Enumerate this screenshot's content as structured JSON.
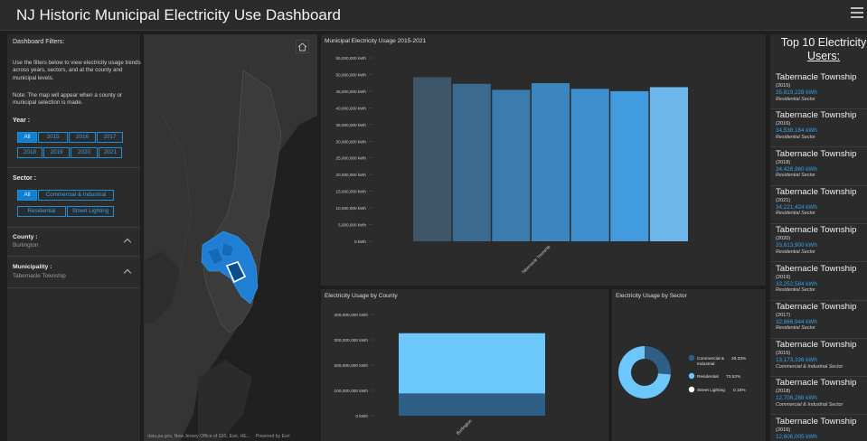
{
  "header": {
    "title": "NJ Historic Municipal Electricity Use Dashboard"
  },
  "filters": {
    "heading": "Dashboard Filters:",
    "intro": "Use the filters below to view electricity usage trends across years, sectors, and at the county and municipal levels.",
    "note": "Note: The map will appear when a county or municipal selection is made.",
    "year_label": "Year :",
    "years": [
      "All",
      "2015",
      "2016",
      "2017",
      "2018",
      "2019",
      "2020",
      "2021"
    ],
    "year_selected": "All",
    "sector_label": "Sector :",
    "sectors": [
      "All",
      "Commercial & Industrial",
      "Residential",
      "Street Lighting"
    ],
    "sector_selected": "All",
    "county_label": "County :",
    "county_value": "Burlington",
    "municipality_label": "Municipality :",
    "municipality_value": "Tabernacle Township"
  },
  "map": {
    "attribution": "data.pa.gov, New Jersey Office of GIS, Esri, HE...",
    "powered_by": "Powered by Esri",
    "home_icon": "home-icon"
  },
  "usage_chart": {
    "title": "Municipal Electricity Usage 2015-2021"
  },
  "county_chart": {
    "title": "Electricity Usage by County"
  },
  "sector_chart": {
    "title": "Electricity Usage by Sector"
  },
  "chart_data": [
    {
      "type": "bar",
      "title": "Municipal Electricity Usage 2015-2021",
      "categories": [
        "Tabernacle Township"
      ],
      "series": [
        {
          "values": [
            49200000
          ],
          "color": "#3f5568"
        },
        {
          "values": [
            47200000
          ],
          "color": "#3b6a90"
        },
        {
          "values": [
            45400000
          ],
          "color": "#3b7bae"
        },
        {
          "values": [
            47400000
          ],
          "color": "#3c86c0"
        },
        {
          "values": [
            45700000
          ],
          "color": "#3f8fcf"
        },
        {
          "values": [
            45000000
          ],
          "color": "#439bdf"
        },
        {
          "values": [
            46200000
          ],
          "color": "#6db6ea"
        }
      ],
      "y_ticks": [
        "0 kWh",
        "5,000,000 kWh",
        "10,000,000 kWh",
        "15,000,000 kWh",
        "20,000,000 kWh",
        "25,000,000 kWh",
        "30,000,000 kWh",
        "35,000,000 kWh",
        "40,000,000 kWh",
        "45,000,000 kWh",
        "50,000,000 kWh",
        "55,000,000 kWh"
      ],
      "ylim": [
        0,
        55000000
      ],
      "grid": false
    },
    {
      "type": "bar",
      "title": "Electricity Usage by County",
      "categories": [
        "Burlington"
      ],
      "stacked": true,
      "series": [
        {
          "values": [
            88000000
          ],
          "color": "#2e5f86"
        },
        {
          "values": [
            238000000
          ],
          "color": "#6cc8fb"
        }
      ],
      "y_ticks": [
        "0 kWh",
        "100,000,000 kWh",
        "200,000,000 kWh",
        "300,000,000 kWh",
        "400,000,000 kWh"
      ],
      "ylim": [
        0,
        400000000
      ],
      "grid": false
    },
    {
      "type": "pie",
      "title": "Electricity Usage by Sector",
      "donut": true,
      "slices": [
        {
          "name": "Commercial & Industrial",
          "value": 26.33,
          "label": "26.33%",
          "color": "#2e5f86"
        },
        {
          "name": "Residential",
          "value": 73.52,
          "label": "73.52%",
          "color": "#6cc8fb"
        },
        {
          "name": "Street Lighting",
          "value": 0.15,
          "label": "0.15%",
          "color": "#ffffff"
        }
      ],
      "legend": "right"
    }
  ],
  "top10": {
    "title_line1": "Top 10 Electricity",
    "title_line2": "Users:",
    "entries": [
      {
        "name": "Tabernacle Township",
        "year": "(2015)",
        "value": "35,819,228 kWh",
        "sector": "Residential Sector"
      },
      {
        "name": "Tabernacle Township",
        "year": "(2016)",
        "value": "34,538,184 kWh",
        "sector": "Residential Sector"
      },
      {
        "name": "Tabernacle Township",
        "year": "(2018)",
        "value": "34,428,960 kWh",
        "sector": "Residential Sector"
      },
      {
        "name": "Tabernacle Township",
        "year": "(2021)",
        "value": "34,221,424 kWh",
        "sector": "Residential Sector"
      },
      {
        "name": "Tabernacle Township",
        "year": "(2020)",
        "value": "33,613,900 kWh",
        "sector": "Residential Sector"
      },
      {
        "name": "Tabernacle Township",
        "year": "(2019)",
        "value": "33,252,584 kWh",
        "sector": "Residential Sector"
      },
      {
        "name": "Tabernacle Township",
        "year": "(2017)",
        "value": "32,866,944 kWh",
        "sector": "Residential Sector"
      },
      {
        "name": "Tabernacle Township",
        "year": "(2015)",
        "value": "13,173,336 kWh",
        "sector": "Commercial & Industrial Sector"
      },
      {
        "name": "Tabernacle Township",
        "year": "(2018)",
        "value": "12,706,288 kWh",
        "sector": "Commercial & Industrial Sector"
      },
      {
        "name": "Tabernacle Township",
        "year": "(2016)",
        "value": "12,606,005 kWh",
        "sector": ""
      }
    ]
  }
}
